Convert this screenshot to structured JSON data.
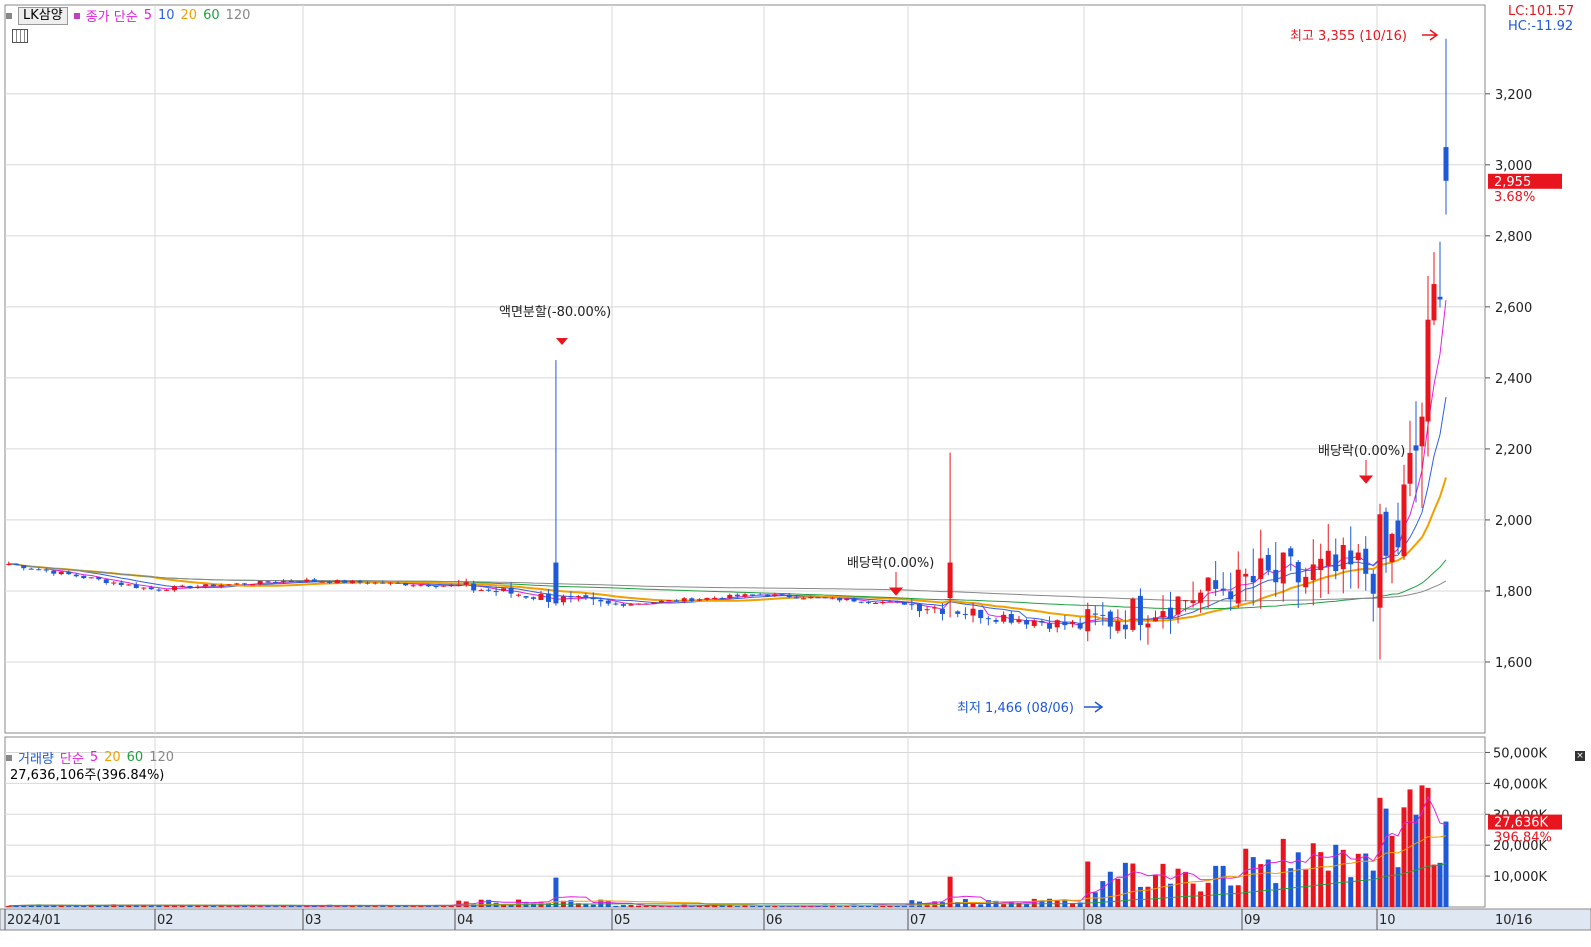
{
  "header": {
    "stock_name": "LK삼양",
    "price_label": "종가 단순",
    "ma": [
      {
        "label": "5",
        "color": "#e020e0"
      },
      {
        "label": "10",
        "color": "#3060e0"
      },
      {
        "label": "20",
        "color": "#f0a000"
      },
      {
        "label": "60",
        "color": "#20a040"
      },
      {
        "label": "120",
        "color": "#888888"
      }
    ],
    "lc": "LC:101.57",
    "hc": "HC:-11.92"
  },
  "volume_header": {
    "title": "거래량",
    "label": "단순",
    "ma": [
      {
        "label": "5",
        "color": "#e020e0"
      },
      {
        "label": "20",
        "color": "#f0a000"
      },
      {
        "label": "60",
        "color": "#20a040"
      },
      {
        "label": "120",
        "color": "#888888"
      }
    ],
    "current": "27,636,106주(396.84%)"
  },
  "colors": {
    "up": "#e8141e",
    "down": "#1e5ad8",
    "grid": "#d8d8d8",
    "axis_bg": "#dfe8f2"
  },
  "chart_data": [
    {
      "type": "candlestick",
      "ylim": [
        1400,
        3450
      ],
      "y_ticks": [
        "1,600",
        "1,800",
        "2,000",
        "2,200",
        "2,400",
        "2,600",
        "2,800",
        "3,000",
        "3,200"
      ],
      "x_ticks": [
        "2024/01",
        "02",
        "03",
        "04",
        "05",
        "06",
        "07",
        "08",
        "09",
        "10"
      ],
      "x_end_label": "10/16",
      "current_price": "2,955",
      "current_change": "3.68%",
      "annotations": [
        {
          "text": "최고 3,355 (10/16)",
          "value": 3355,
          "color": "#e8141e"
        },
        {
          "text": "최저 1,466 (08/06)",
          "value": 1466,
          "color": "#1e5ad8"
        },
        {
          "text": "액면분할(-80.00%)",
          "color": "#222"
        },
        {
          "text": "배당락(0.00%)",
          "color": "#222"
        },
        {
          "text": "배당락(0.00%)",
          "color": "#222"
        }
      ],
      "months": [
        {
          "m": "01",
          "days": 20,
          "start": 1880,
          "end": 1805,
          "vol": 0.3
        },
        {
          "m": "02",
          "days": 19,
          "start": 1805,
          "end": 1830,
          "vol": 0.25
        },
        {
          "m": "03",
          "days": 20,
          "start": 1830,
          "end": 1815,
          "vol": 0.25
        },
        {
          "m": "04",
          "days": 21,
          "start": 1815,
          "end": 1760,
          "vol": 0.8
        },
        {
          "m": "05",
          "days": 20,
          "start": 1760,
          "end": 1790,
          "vol": 0.25
        },
        {
          "m": "06",
          "days": 20,
          "start": 1790,
          "end": 1765,
          "vol": 0.25
        },
        {
          "m": "07",
          "days": 23,
          "start": 1765,
          "end": 1700,
          "vol": 0.9
        },
        {
          "m": "08",
          "days": 21,
          "start": 1700,
          "end": 1820,
          "vol": 2.5
        },
        {
          "m": "09",
          "days": 18,
          "start": 1820,
          "end": 1860,
          "vol": 4
        },
        {
          "m": "10",
          "days": 12,
          "start": 1860,
          "end": 2955,
          "vol": 8
        }
      ]
    },
    {
      "type": "bar",
      "ylim": [
        0,
        55000
      ],
      "y_ticks": [
        "10,000K",
        "20,000K",
        "30,000K",
        "40,000K",
        "50,000K"
      ],
      "current_volume": "27,636K",
      "current_change": "396.84%"
    }
  ]
}
